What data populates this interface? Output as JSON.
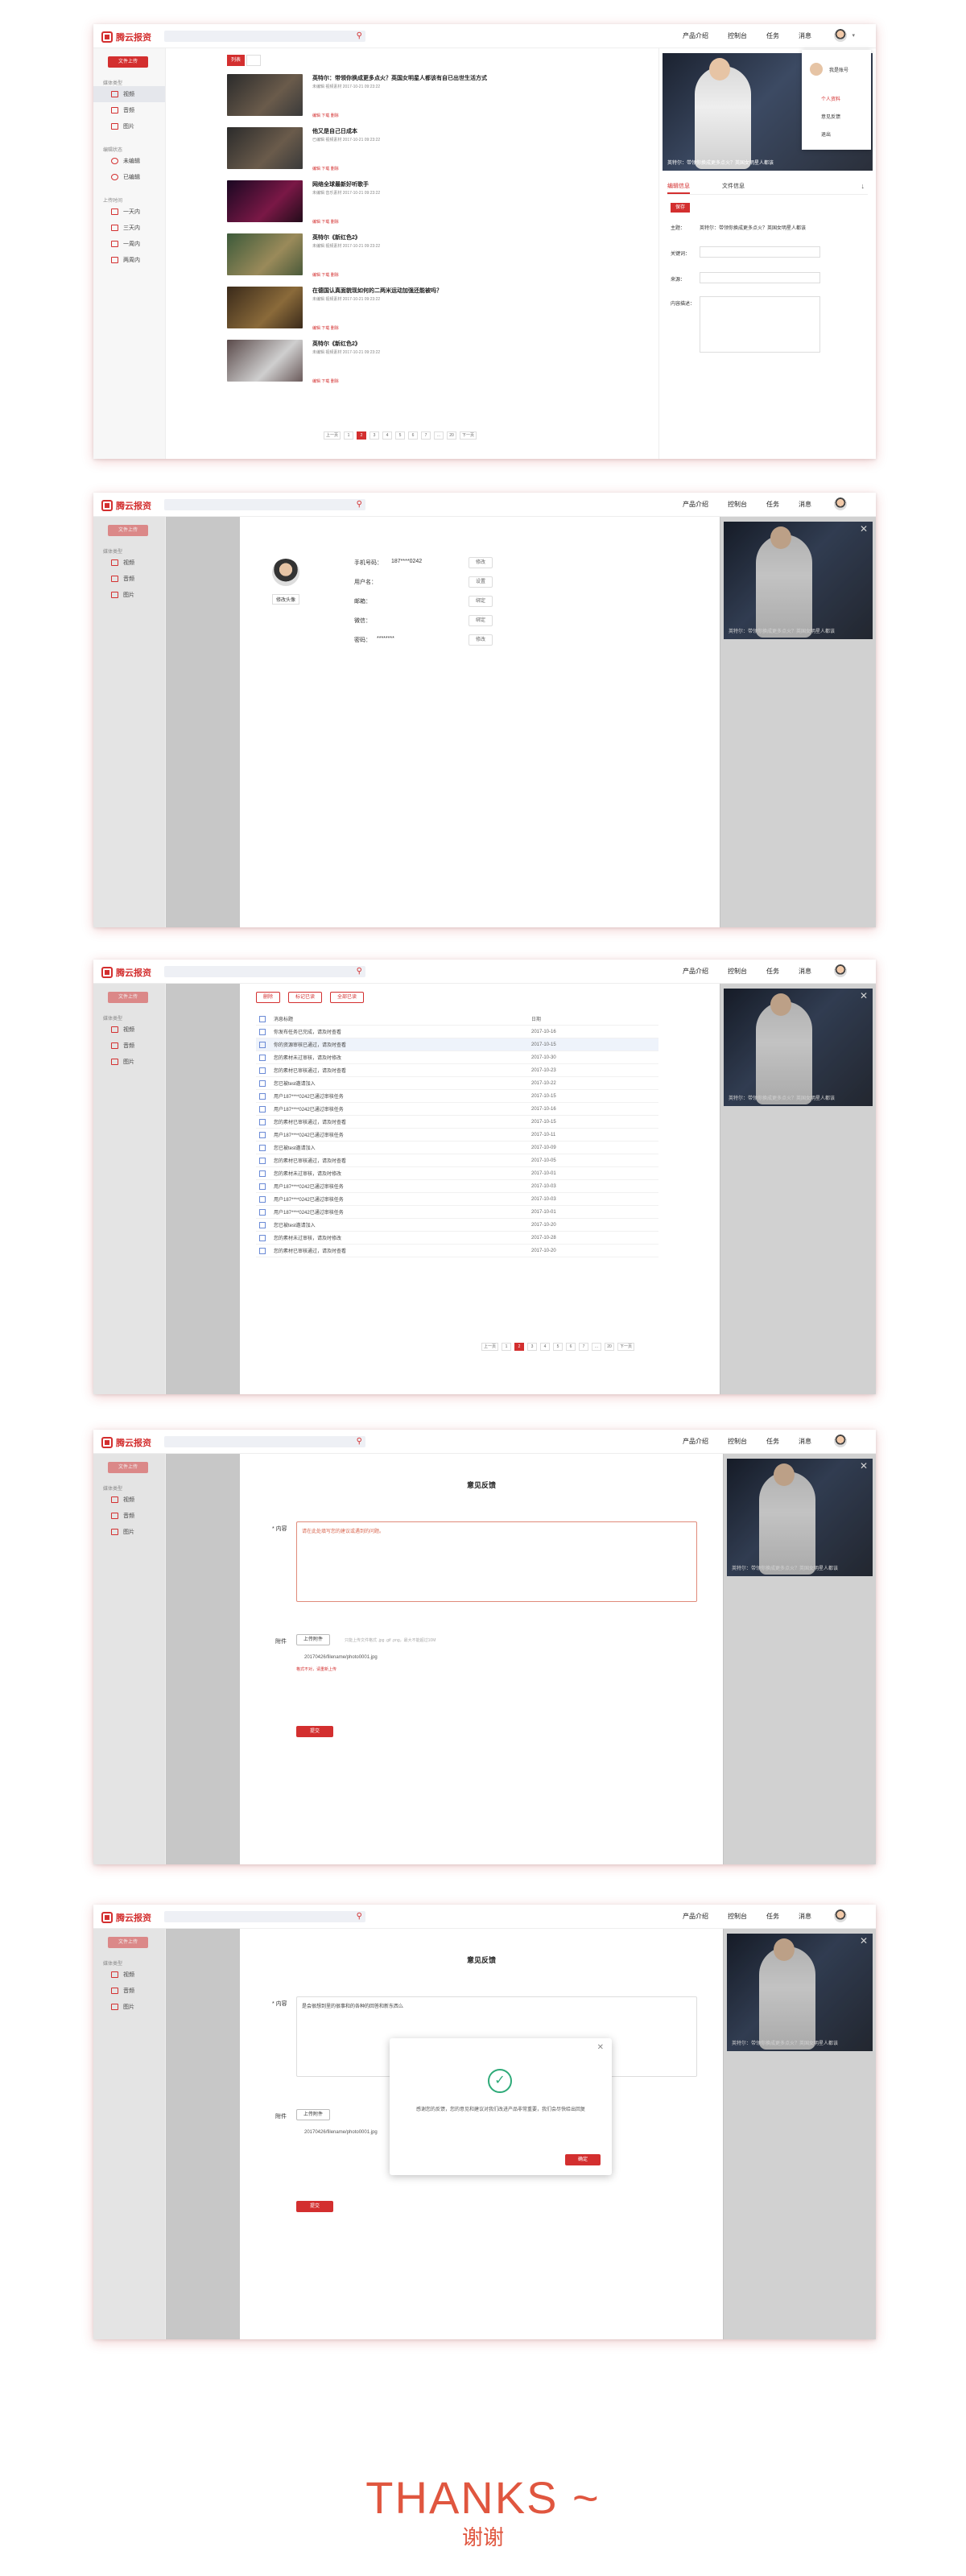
{
  "header": {
    "logo": "腾云报资",
    "search_placeholder": "",
    "nav": [
      "产品介绍",
      "控制台",
      "任务",
      "消息"
    ]
  },
  "sidebar": {
    "upload": "文件上传",
    "group1": "媒体类型",
    "types": [
      "视频",
      "音频",
      "图片"
    ],
    "group2": "编辑状态",
    "status": [
      "未编辑",
      "已编辑"
    ],
    "group3": "上传时间",
    "time": [
      "一天内",
      "三天内",
      "一周内",
      "两周内"
    ]
  },
  "screen1": {
    "view_btn": "列表",
    "items": [
      {
        "title": "英特尔：带领你换成更多点火？英国女明星人都该有自已出世生活方式",
        "meta": "未编辑    视频素材    2017-10-21 09:23:22",
        "actions": "编辑    下载    删除"
      },
      {
        "title": "他又是自己日成本",
        "meta": "已编辑    视频素材    2017-10-21 09:23:22",
        "actions": "编辑    下载    删除"
      },
      {
        "title": "网络全球最新好听歌手",
        "meta": "未编辑    音乐素材    2017-10-21 09:23:22",
        "actions": "编辑    下载    删除"
      },
      {
        "title": "英特尔《新红色2》",
        "meta": "未编辑    视频素材    2017-10-21 09:23:22",
        "actions": "编辑    下载    删除"
      },
      {
        "title": "在德国认真面貌现如何的二两米运动加强还能被吗？",
        "meta": "未编辑    视频素材    2017-10-21 09:23:22",
        "actions": "编辑    下载    删除"
      },
      {
        "title": "英特尔《新红色2》",
        "meta": "未编辑    视频素材    2017-10-21 09:23:22",
        "actions": "编辑    下载    删除"
      }
    ],
    "pager": [
      "上一页",
      "1",
      "2",
      "3",
      "4",
      "5",
      "6",
      "7",
      "...",
      "20",
      "下一页"
    ],
    "menu": [
      "我是账号",
      "个人资料",
      "意见反馈",
      "退出"
    ],
    "right_tabs": [
      "编辑信息",
      "文件信息"
    ],
    "right_btn": "保存",
    "fields": [
      "主题：",
      "关键词：",
      "来源：",
      "内容描述："
    ],
    "field_value": "英特尔：带领你换成更多点火？英国女明星人都该"
  },
  "screen2": {
    "avatar_btn": "修改头像",
    "rows": [
      {
        "label": "手机号码：",
        "value": "187****0242",
        "btn": "修改"
      },
      {
        "label": "用户名：",
        "value": "",
        "btn": "设置"
      },
      {
        "label": "邮箱：",
        "value": "",
        "btn": "绑定"
      },
      {
        "label": "微信：",
        "value": "",
        "btn": "绑定"
      },
      {
        "label": "密码：",
        "value": "********",
        "btn": "修改"
      }
    ]
  },
  "screen3": {
    "toolbar": [
      "删除",
      "标记已读",
      "全部已读"
    ],
    "head": [
      "消息标题",
      "日期"
    ],
    "rows": [
      [
        "你发布任务已完成，请及时查看",
        "2017-10-16"
      ],
      [
        "你的资源审核已通过，请及时查看",
        "2017-10-15"
      ],
      [
        "您的素材未过审核，请及时修改",
        "2017-10-30"
      ],
      [
        "您的素材已审核通过，请及时查看",
        "2017-10-23"
      ],
      [
        "您已被test邀请加入",
        "2017-10-22"
      ],
      [
        "用户187****0242已通过审核任务",
        "2017-10-15"
      ],
      [
        "用户187****0242已通过审核任务",
        "2017-10-16"
      ],
      [
        "您的素材已审核通过，请及时查看",
        "2017-10-15"
      ],
      [
        "用户187****0242已通过审核任务",
        "2017-10-11"
      ],
      [
        "您已被test邀请加入",
        "2017-10-09"
      ],
      [
        "您的素材已审核通过，请及时查看",
        "2017-10-05"
      ],
      [
        "您的素材未过审核，请及时修改",
        "2017-10-01"
      ],
      [
        "用户187****0242已通过审核任务",
        "2017-10-03"
      ],
      [
        "用户187****0242已通过审核任务",
        "2017-10-03"
      ],
      [
        "用户187****0242已通过审核任务",
        "2017-10-01"
      ],
      [
        "您已被test邀请加入",
        "2017-10-20"
      ],
      [
        "您的素材未过审核，请及时修改",
        "2017-10-28"
      ],
      [
        "您的素材已审核通过，请及时查看",
        "2017-10-20"
      ]
    ],
    "pager": [
      "上一页",
      "1",
      "2",
      "3",
      "4",
      "5",
      "6",
      "7",
      "...",
      "20",
      "下一页"
    ]
  },
  "screen4": {
    "title": "意见反馈",
    "content_label": "* 内容",
    "placeholder": "请在此处填写您的建议或遇到的问题。",
    "attach_label": "附件",
    "upload_btn": "上传附件",
    "upload_hint": "只能上传文件格式 .jpg .gif .png，最大不能超过10M",
    "file": "20170426/filename/photo0001.jpg",
    "error": "格式不对，请重新上传",
    "submit": "提交"
  },
  "screen5": {
    "title": "意见反馈",
    "content_label": "* 内容",
    "content": "是会很想到里的很事和的各种的回答和新东西么",
    "attach_label": "附件",
    "upload_btn": "上传附件",
    "file": "20170426/filename/photo0001.jpg",
    "submit": "提交",
    "modal_msg": "感谢您的反馈，您的意见和建议对我们改进产品非常重要，我们会尽快给出回复",
    "modal_btn": "确定"
  },
  "video_caption": "英特尔：带领你换成更多点火？英国女明星人都该",
  "thanks": "THANKS ~",
  "thanks_cn": "谢谢"
}
